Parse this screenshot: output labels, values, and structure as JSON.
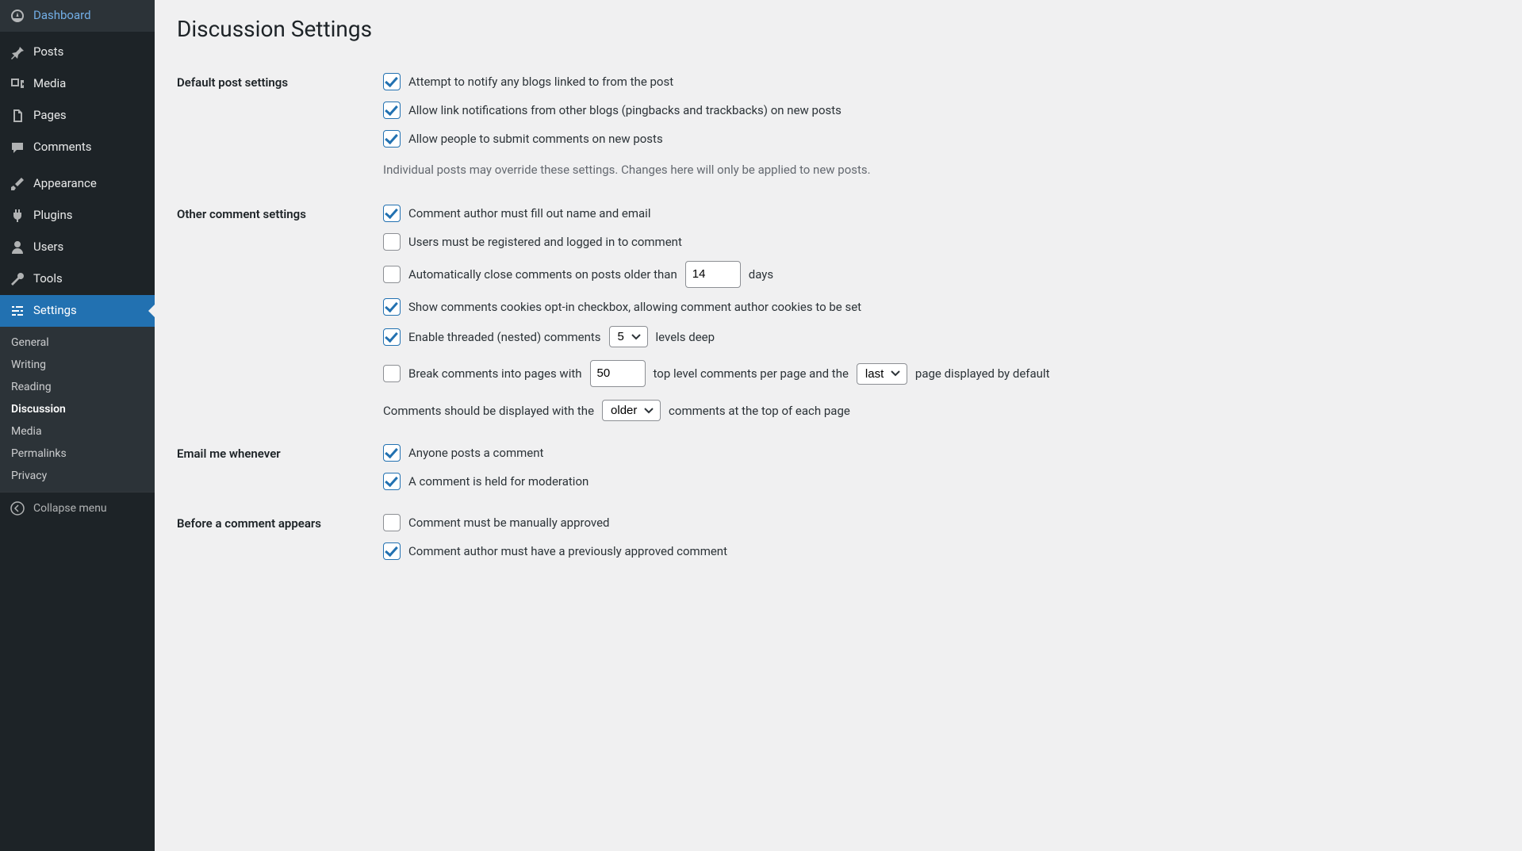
{
  "sidebar": {
    "items": [
      {
        "label": "Dashboard",
        "icon": "dashboard"
      },
      {
        "label": "Posts",
        "icon": "pin"
      },
      {
        "label": "Media",
        "icon": "media"
      },
      {
        "label": "Pages",
        "icon": "pages"
      },
      {
        "label": "Comments",
        "icon": "comment"
      },
      {
        "label": "Appearance",
        "icon": "brush"
      },
      {
        "label": "Plugins",
        "icon": "plug"
      },
      {
        "label": "Users",
        "icon": "user"
      },
      {
        "label": "Tools",
        "icon": "wrench"
      },
      {
        "label": "Settings",
        "icon": "sliders"
      }
    ],
    "submenu": {
      "general": "General",
      "writing": "Writing",
      "reading": "Reading",
      "discussion": "Discussion",
      "media": "Media",
      "permalinks": "Permalinks",
      "privacy": "Privacy"
    },
    "collapse": "Collapse menu"
  },
  "page_title": "Discussion Settings",
  "sections": {
    "default_post": {
      "heading": "Default post settings",
      "notify_linked": "Attempt to notify any blogs linked to from the post",
      "allow_pingbacks": "Allow link notifications from other blogs (pingbacks and trackbacks) on new posts",
      "allow_comments": "Allow people to submit comments on new posts",
      "note": "Individual posts may override these settings. Changes here will only be applied to new posts."
    },
    "other_comment": {
      "heading": "Other comment settings",
      "require_name_email": "Comment author must fill out name and email",
      "require_registration": "Users must be registered and logged in to comment",
      "auto_close_pre": "Automatically close comments on posts older than",
      "auto_close_days": "14",
      "auto_close_post": "days",
      "show_cookies_optin": "Show comments cookies opt-in checkbox, allowing comment author cookies to be set",
      "threaded_pre": "Enable threaded (nested) comments",
      "threaded_depth": "5",
      "threaded_post": "levels deep",
      "paginate_pre": "Break comments into pages with",
      "paginate_count": "50",
      "paginate_mid": "top level comments per page and the",
      "paginate_default_page": "last",
      "paginate_post": "page displayed by default",
      "order_pre": "Comments should be displayed with the",
      "order_value": "older",
      "order_post": "comments at the top of each page"
    },
    "email_me": {
      "heading": "Email me whenever",
      "anyone_posts": "Anyone posts a comment",
      "held_moderation": "A comment is held for moderation"
    },
    "before_appears": {
      "heading": "Before a comment appears",
      "manual_approve": "Comment must be manually approved",
      "prev_approved": "Comment author must have a previously approved comment"
    }
  }
}
